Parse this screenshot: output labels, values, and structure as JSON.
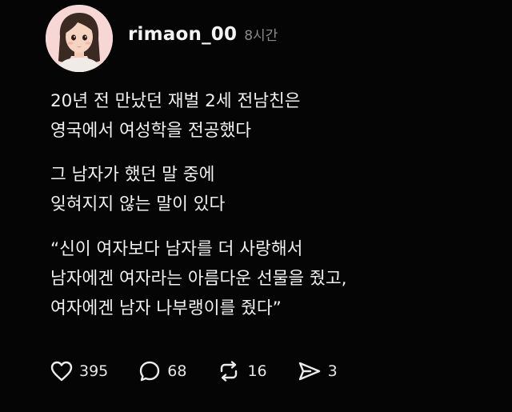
{
  "post": {
    "username": "rimaon_00",
    "time": "8시간",
    "paragraphs": [
      [
        "20년 전 만났던 재벌 2세 전남친은",
        "영국에서 여성학을 전공했다"
      ],
      [
        "그 남자가 했던 말 중에",
        "잊혀지지 않는 말이 있다"
      ],
      [
        "“신이 여자보다 남자를 더 사랑해서",
        "남자에겐 여자라는 아름다운 선물을 줬고,",
        "여자에겐 남자 나부랭이를 줬다”"
      ]
    ]
  },
  "actions": {
    "like": {
      "icon": "heart-icon",
      "count": "395"
    },
    "comment": {
      "icon": "comment-icon",
      "count": "68"
    },
    "repost": {
      "icon": "repost-icon",
      "count": "16"
    },
    "share": {
      "icon": "send-icon",
      "count": "3"
    }
  },
  "colors": {
    "background": "#050505",
    "text": "#f1f1f1",
    "muted": "#8a8a8a",
    "avatar_bg": "#f6d7d6"
  }
}
